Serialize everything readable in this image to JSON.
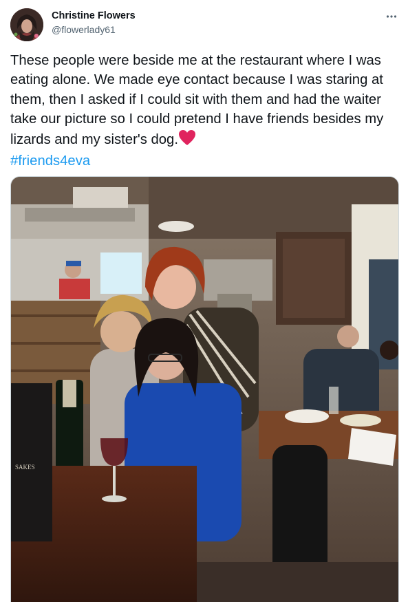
{
  "tweet": {
    "author": {
      "name": "Christine Flowers",
      "handle": "@flowerlady61",
      "avatar_icon": "profile-photo"
    },
    "more_icon": "ellipsis-icon",
    "text": "These people were beside me at the restaurant where I was eating alone. We made eye contact because I was staring at them, then I asked if I could sit with them and had the waiter take our picture so I could pretend I have friends besides my lizards and my sister's dog.",
    "emoji": "❤",
    "hashtag": "#friends4eva",
    "media": {
      "description_icon": "photo-restaurant-friends",
      "bottle_label": "SAKES"
    }
  },
  "colors": {
    "text_primary": "#0f1419",
    "text_secondary": "#536471",
    "link": "#1d9bf0",
    "heart": "#e0245e",
    "border": "#cfd9de"
  }
}
